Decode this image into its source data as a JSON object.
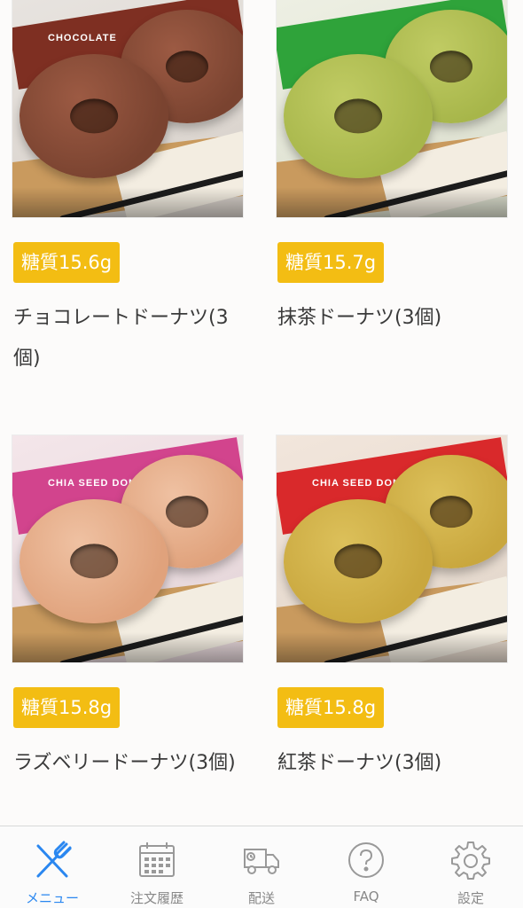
{
  "products": [
    {
      "badge": "糖質15.6g",
      "title": "チョコレートドーナツ(3個)",
      "photo": {
        "bag_label": "CHOCOLATE",
        "bag_color": "#7e2f22",
        "donut_color": "#7a4330",
        "donut_highlight": "#9c5a43"
      }
    },
    {
      "badge": "糖質15.7g",
      "title": "抹茶ドーナツ(3個)",
      "photo": {
        "bag_label": "",
        "bag_color": "#2fa33a",
        "donut_color": "#a7b64a",
        "donut_highlight": "#c0cb63"
      }
    },
    {
      "badge": "糖質15.8g",
      "title": "ラズベリードーナツ(3個)",
      "photo": {
        "bag_label": "CHIA SEED DONUT",
        "bag_color": "#d2448d",
        "donut_color": "#e0a27c",
        "donut_highlight": "#efc1a2"
      }
    },
    {
      "badge": "糖質15.8g",
      "title": "紅茶ドーナツ(3個)",
      "photo": {
        "bag_label": "CHIA SEED DONUT",
        "bag_color": "#d9292b",
        "donut_color": "#c9a73e",
        "donut_highlight": "#dcc05a"
      }
    }
  ],
  "tabbar": {
    "active_color": "#2a87f0",
    "inactive_color": "#888888",
    "tabs": [
      {
        "label": "メニュー",
        "icon": "fork-knife-icon",
        "active": true
      },
      {
        "label": "注文履歴",
        "icon": "calendar-icon",
        "active": false
      },
      {
        "label": "配送",
        "icon": "delivery-truck-icon",
        "active": false
      },
      {
        "label": "FAQ",
        "icon": "question-circle-icon",
        "active": false
      },
      {
        "label": "設定",
        "icon": "gear-icon",
        "active": false
      }
    ]
  },
  "colors": {
    "badge_bg": "#f3bd13",
    "badge_text": "#ffffff",
    "background": "#fcfbfa"
  }
}
